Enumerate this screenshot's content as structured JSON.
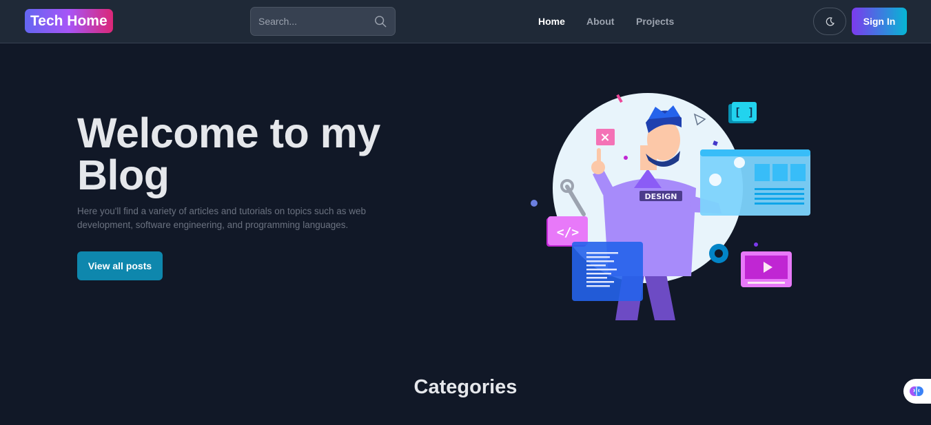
{
  "header": {
    "logo": "Tech Home",
    "search": {
      "placeholder": "Search...",
      "icon": "search-icon"
    },
    "nav": [
      {
        "label": "Home",
        "active": true
      },
      {
        "label": "About",
        "active": false
      },
      {
        "label": "Projects",
        "active": false
      }
    ],
    "theme_toggle_icon": "moon-icon",
    "signin_label": "Sign In"
  },
  "hero": {
    "title": "Welcome to my Blog",
    "description": "Here you'll find a variety of articles and tutorials on topics such as web development, software engineering, and programming languages.",
    "cta_label": "View all posts",
    "illustration_badge": "DESIGN"
  },
  "categories": {
    "title": "Categories"
  },
  "colors": {
    "background": "#111827",
    "header": "#1f2937",
    "cta": "#0e87ad",
    "accent_purple": "#7c3aed",
    "accent_cyan": "#06b6d4"
  }
}
